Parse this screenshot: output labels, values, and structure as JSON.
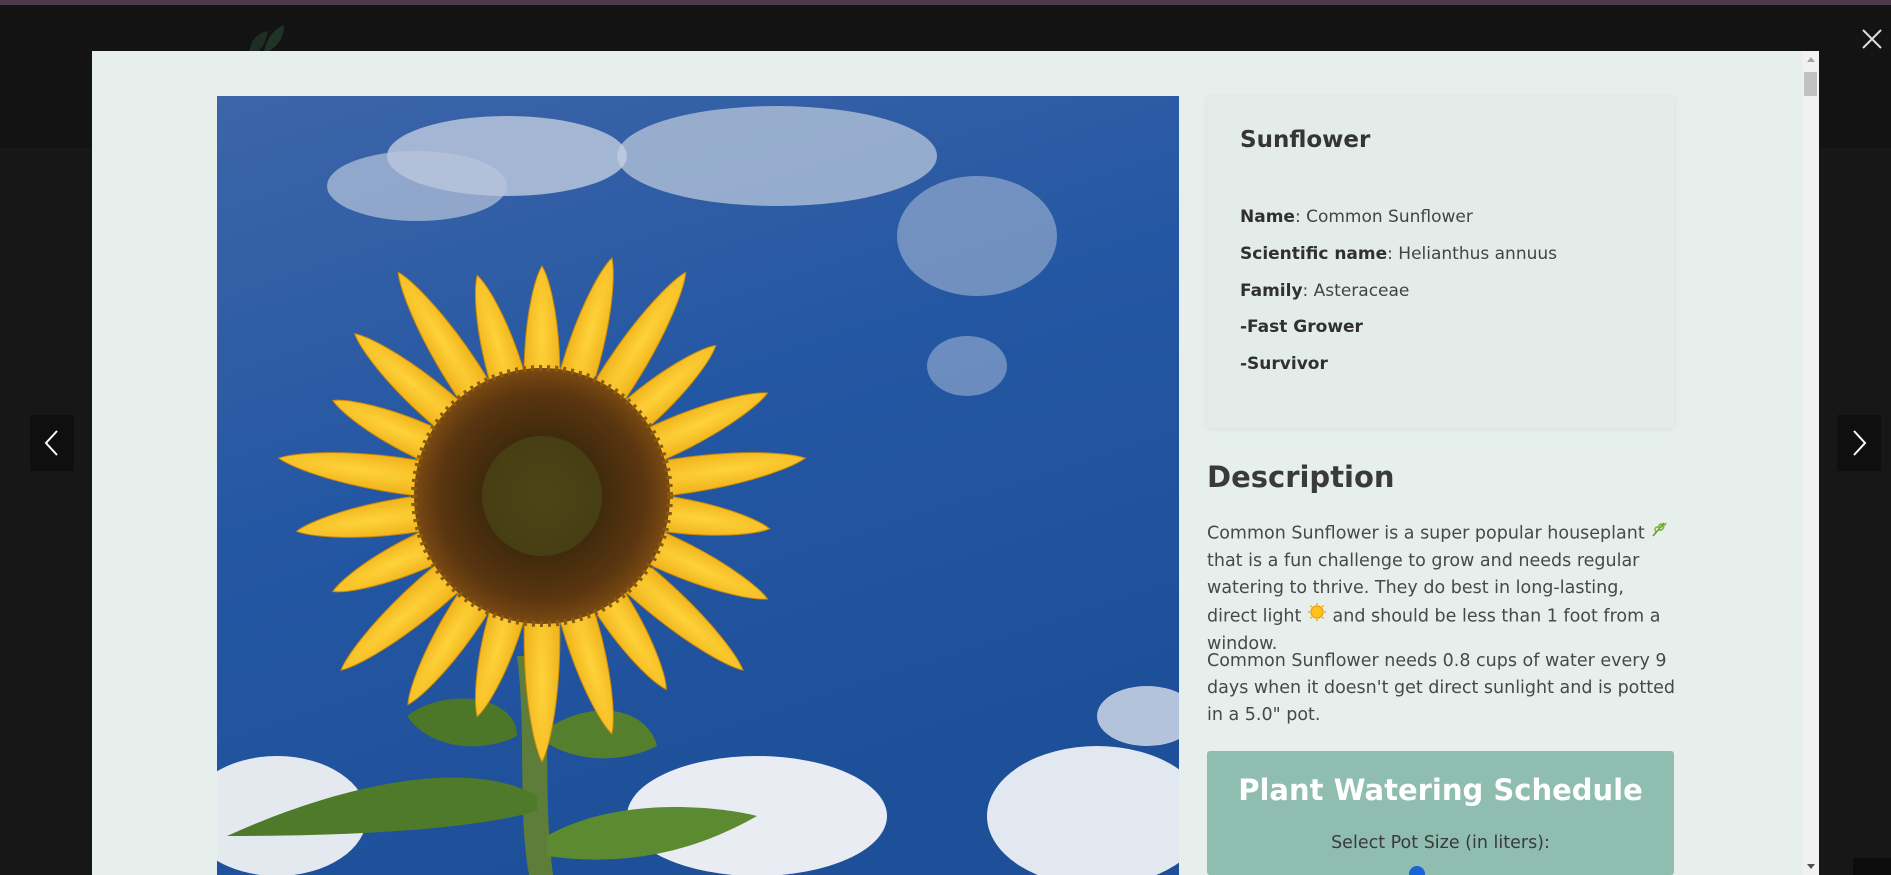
{
  "plant": {
    "title": "Sunflower",
    "details": [
      {
        "label": "Name",
        "value": ": Common Sunflower"
      },
      {
        "label": "Scientific name",
        "value": ": Helianthus annuus"
      },
      {
        "label": "Family",
        "value": ": Asteraceae"
      }
    ],
    "traits": [
      "-Fast Grower",
      "-Survivor"
    ]
  },
  "description": {
    "heading": "Description",
    "para1": {
      "part1": "Common Sunflower is a super popular houseplant ",
      "part2": " that is a fun challenge to grow and needs regular watering to thrive. They do best in long-lasting, direct light ",
      "part3": " and should be less than 1 foot from a window."
    },
    "para2": "Common Sunflower needs 0.8 cups of water every 9 days when it doesn't get direct sunlight and is potted in a 5.0\" pot."
  },
  "schedule": {
    "title": "Plant Watering Schedule",
    "pot_label": "Select Pot Size (in liters):"
  },
  "icons": {
    "close": "close-icon",
    "prev": "chevron-left-icon",
    "next": "chevron-right-icon",
    "herb": "herb-emoji-icon",
    "sun": "sun-emoji-icon",
    "logo": "leaf-logo-icon"
  },
  "colors": {
    "modal_bg": "#e6efeb",
    "schedule_bg": "#8fbdb0",
    "slider_accent": "#1a64d9",
    "backdrop": "#171717"
  }
}
